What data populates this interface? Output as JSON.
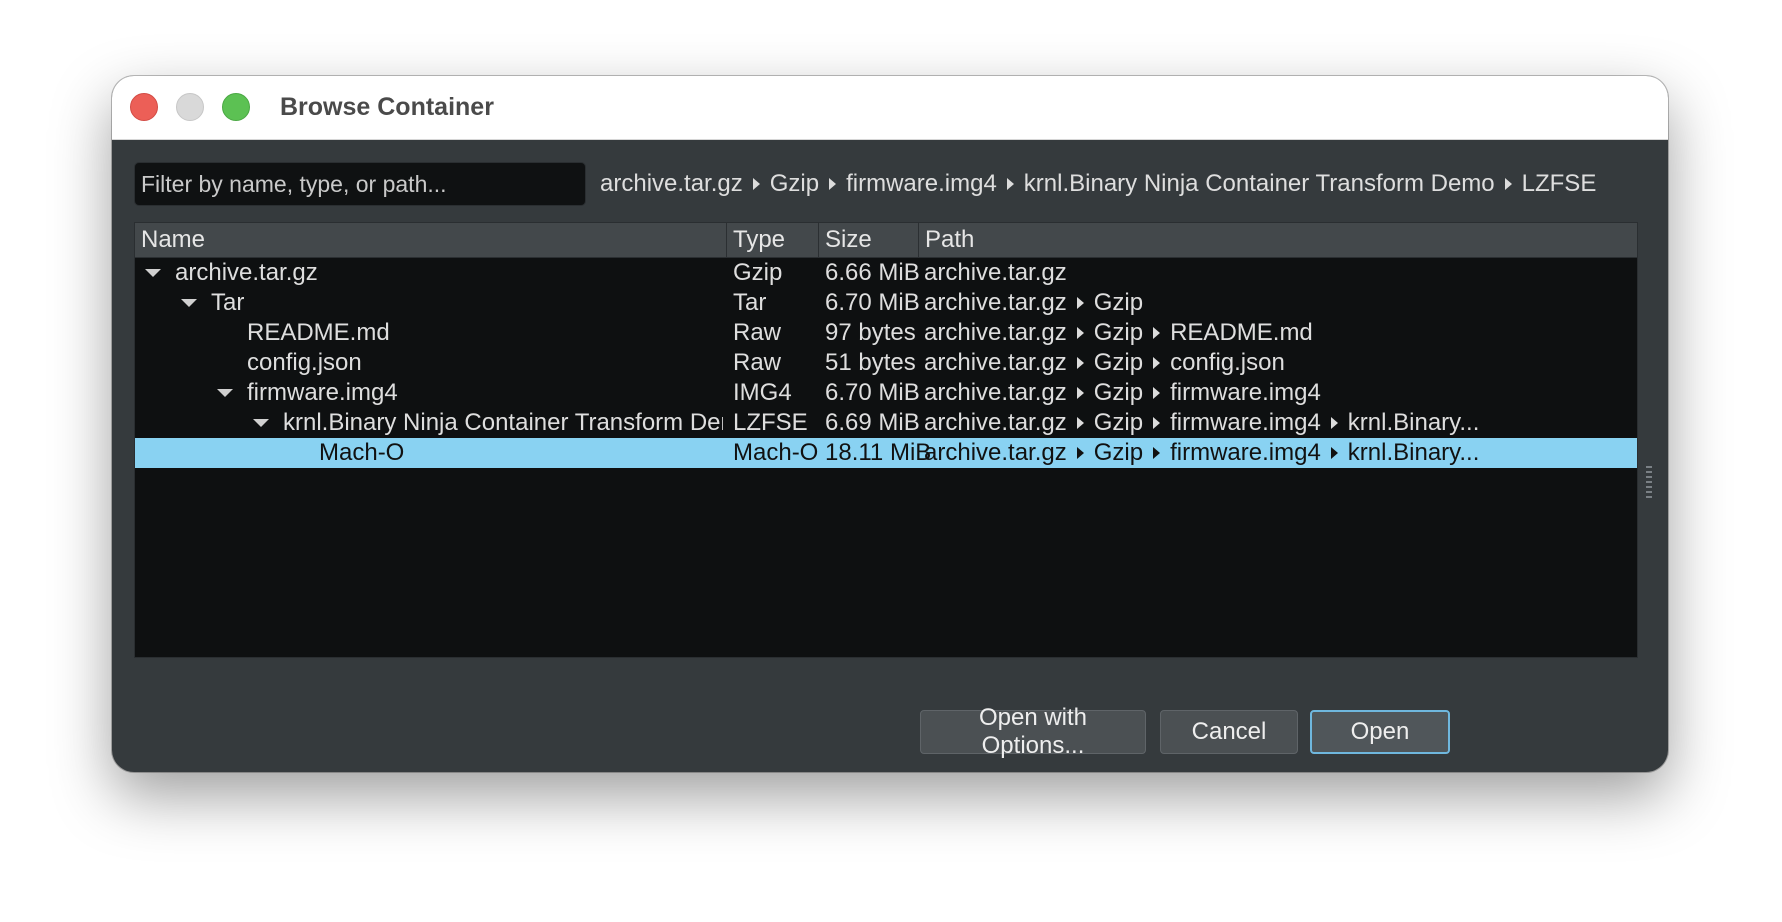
{
  "window": {
    "title": "Browse Container"
  },
  "filter": {
    "placeholder": "Filter by name, type, or path..."
  },
  "breadcrumb": [
    "archive.tar.gz",
    "Gzip",
    "firmware.img4",
    "krnl.Binary Ninja Container Transform Demo",
    "LZFSE"
  ],
  "columns": {
    "name": "Name",
    "type": "Type",
    "size": "Size",
    "path": "Path"
  },
  "rows": [
    {
      "name": "archive.tar.gz",
      "type": "Gzip",
      "size": "6.66 MiB",
      "path": [
        "archive.tar.gz"
      ],
      "expanded": true
    },
    {
      "name": "Tar",
      "type": "Tar",
      "size": "6.70 MiB",
      "path": [
        "archive.tar.gz",
        "Gzip"
      ],
      "expanded": true
    },
    {
      "name": "README.md",
      "type": "Raw",
      "size": "97 bytes",
      "path": [
        "archive.tar.gz",
        "Gzip",
        "README.md"
      ]
    },
    {
      "name": "config.json",
      "type": "Raw",
      "size": "51 bytes",
      "path": [
        "archive.tar.gz",
        "Gzip",
        "config.json"
      ]
    },
    {
      "name": "firmware.img4",
      "type": "IMG4",
      "size": "6.70 MiB",
      "path": [
        "archive.tar.gz",
        "Gzip",
        "firmware.img4"
      ],
      "expanded": true
    },
    {
      "name": "krnl.Binary Ninja Container Transform Demo",
      "type": "LZFSE",
      "size": "6.69 MiB",
      "path": [
        "archive.tar.gz",
        "Gzip",
        "firmware.img4",
        "krnl.Binary..."
      ],
      "expanded": true
    },
    {
      "name": "Mach-O",
      "type": "Mach-O",
      "size": "18.11 MiB",
      "path": [
        "archive.tar.gz",
        "Gzip",
        "firmware.img4",
        "krnl.Binary..."
      ],
      "selected": true
    }
  ],
  "buttons": {
    "open_with_options": "Open with Options...",
    "cancel": "Cancel",
    "open": "Open"
  },
  "colors": {
    "selection": "#89d2f2",
    "window_bg": "#353a3d",
    "table_bg": "#0e1011"
  }
}
